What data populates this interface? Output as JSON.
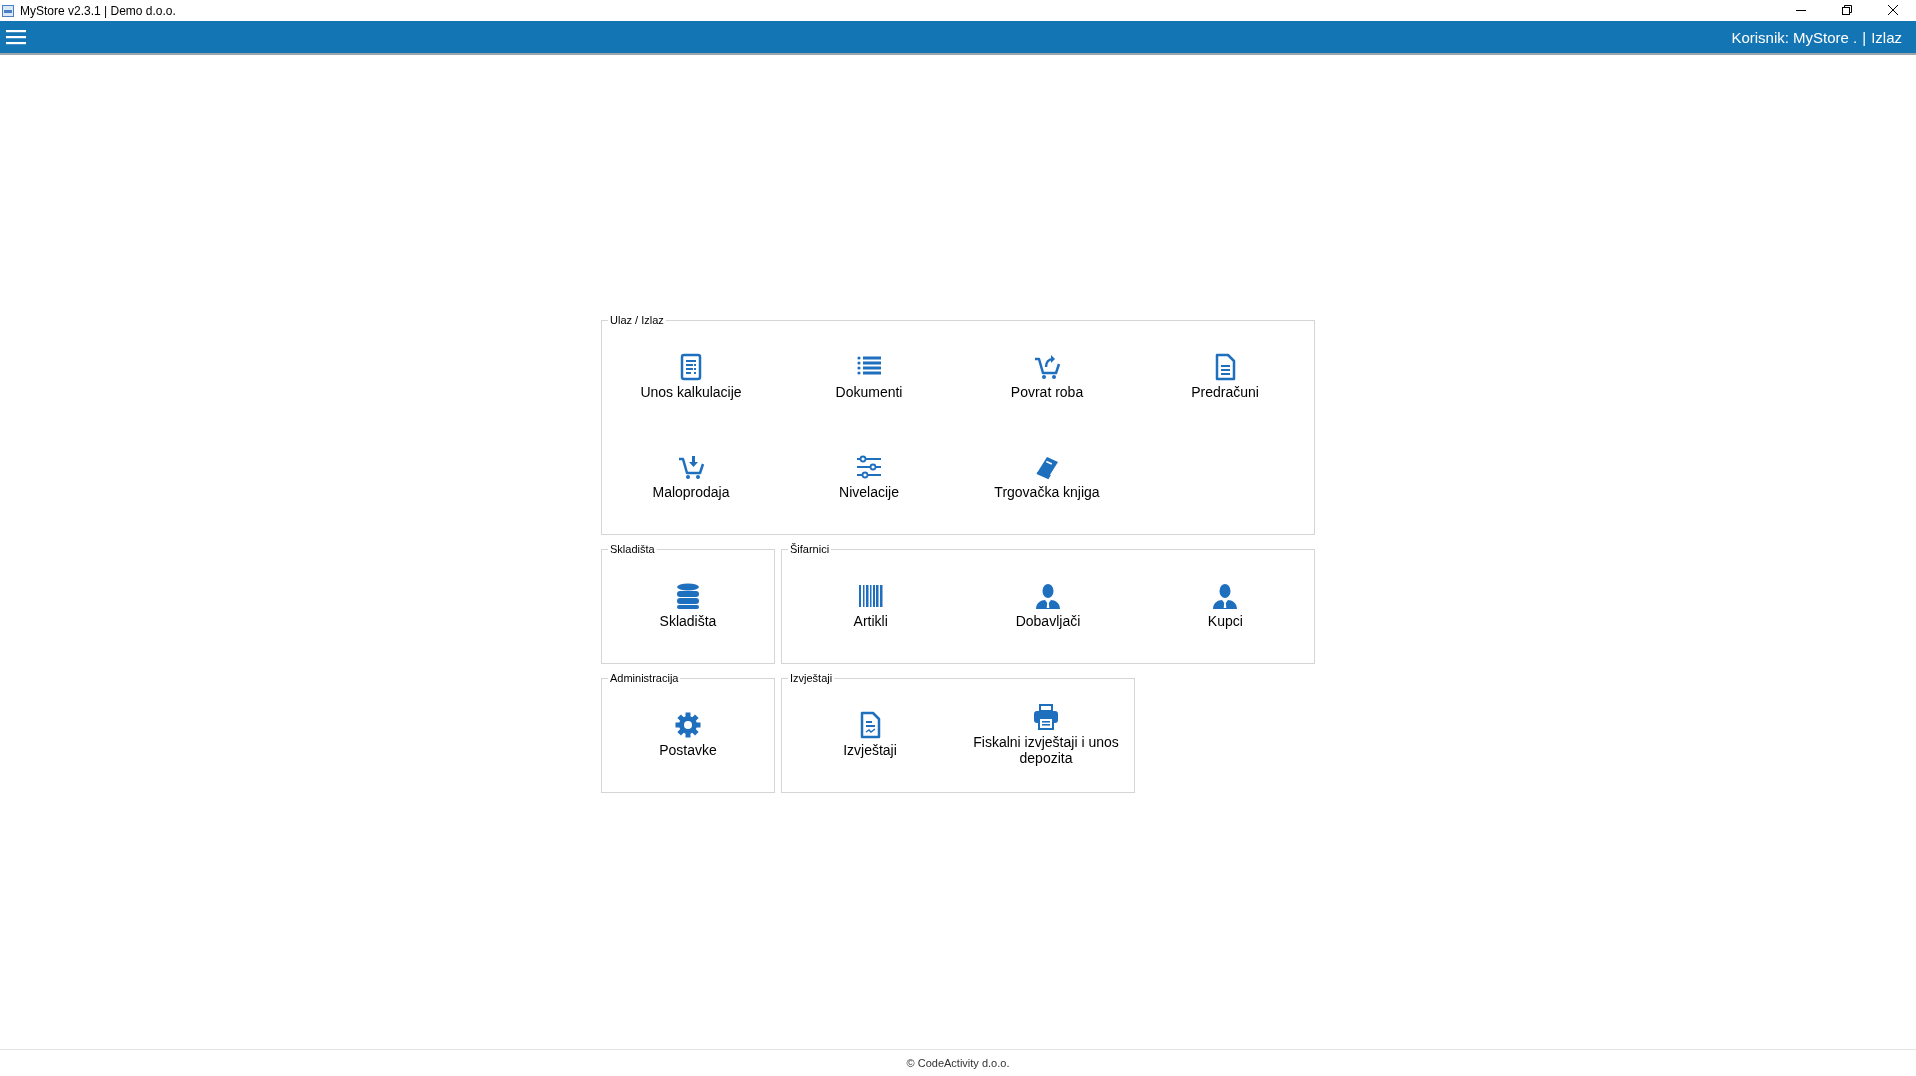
{
  "window": {
    "title": "MyStore v2.3.1 | Demo d.o.o."
  },
  "toolbar": {
    "user": "Korisnik: MyStore .",
    "separator": "|",
    "logout": "Izlaz"
  },
  "groups": [
    {
      "title": "Ulaz / Izlaz",
      "tiles": [
        {
          "label": "Unos kalkulacije",
          "kind": "form"
        },
        {
          "label": "Dokumenti",
          "kind": "list"
        },
        {
          "label": "Povrat roba",
          "kind": "cartreturn"
        },
        {
          "label": "Predračuni",
          "kind": "file"
        },
        {
          "label": "Maloprodaja",
          "kind": "cartdown"
        },
        {
          "label": "Nivelacije",
          "kind": "sliders"
        },
        {
          "label": "Trgovačka knjiga",
          "kind": "book"
        }
      ]
    },
    {
      "title": "Skladišta",
      "tiles": [
        {
          "label": "Skladišta",
          "kind": "database"
        }
      ]
    },
    {
      "title": "Šifarnici",
      "tiles": [
        {
          "label": "Artikli",
          "kind": "barcode"
        },
        {
          "label": "Dobavljači",
          "kind": "person"
        },
        {
          "label": "Kupci",
          "kind": "person"
        }
      ]
    },
    {
      "title": "Administracija",
      "tiles": [
        {
          "label": "Postavke",
          "kind": "gear"
        }
      ]
    },
    {
      "title": "Izvještaji",
      "tiles": [
        {
          "label": "Izvještaji",
          "kind": "report"
        },
        {
          "label": "Fiskalni izvještaji i unos depozita",
          "kind": "printer"
        }
      ]
    }
  ],
  "footer": "© CodeActivity d.o.o."
}
